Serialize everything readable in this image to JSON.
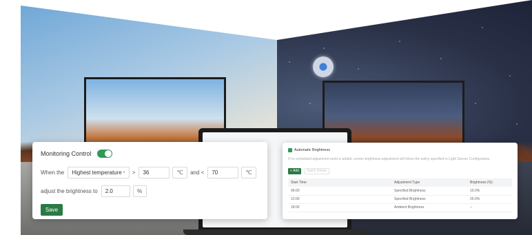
{
  "monitor": {
    "title": "Monitoring Control",
    "when_label": "When the",
    "condition": "Highest temperature",
    "operator": ">",
    "threshold": "36",
    "unit": "℃",
    "and_label": "and <",
    "upper_threshold": "70",
    "upper_unit": "℃",
    "adjust_label": "adjust the brightness to",
    "brightness_value": "2.0",
    "percent": "%",
    "save_label": "Save",
    "toggle_on": true
  },
  "auto_brightness": {
    "title": "Automatic Brightness",
    "description": "If no scheduled adjustment point is added, screen brightness adjustment will follow the policy specified in Light Sensor Configuration.",
    "add_label": "+ Add",
    "delete_label": "Batch Delete",
    "columns": [
      "Start Time",
      "Adjustment Type",
      "Brightness (%)"
    ],
    "rows": [
      [
        "06:00",
        "Specified Brightness",
        "10.0%"
      ],
      [
        "12:00",
        "Specified Brightness",
        "20.0%"
      ],
      [
        "18:00",
        "Ambient Brightness",
        "--"
      ]
    ]
  },
  "colors": {
    "accent": "#2b7a45",
    "toggle": "#2f9a56"
  },
  "icons": {
    "sensor": "light-sensor-icon"
  }
}
